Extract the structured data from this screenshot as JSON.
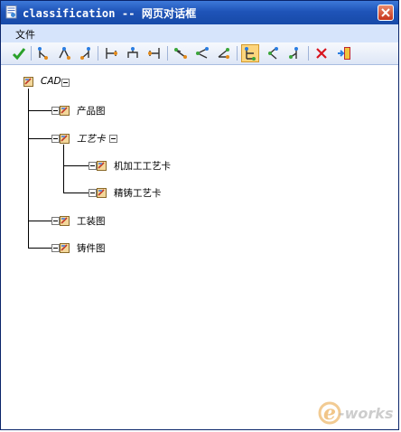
{
  "window": {
    "title": "classification -- 网页对话框"
  },
  "menu": {
    "file": "文件"
  },
  "toolbar": {
    "buttons": [
      "confirm-check-icon",
      "node-tool-1-icon",
      "node-tool-2-icon",
      "node-tool-3-icon",
      "align-tool-1-icon",
      "align-tool-2-icon",
      "align-tool-3-icon",
      "link-tool-1-icon",
      "link-tool-2-icon",
      "link-tool-3-icon",
      "tree-view-icon",
      "tree-tool-2-icon",
      "tree-tool-3-icon",
      "delete-x-icon",
      "exit-door-icon"
    ],
    "active": "tree-view-icon",
    "colors": {
      "check": "#2aa02a",
      "delete": "#d8141e",
      "active_bg": "#fdd57d"
    }
  },
  "tree": {
    "root": {
      "label": "CAD"
    },
    "children": [
      {
        "label": "产品图"
      },
      {
        "label": "工艺卡",
        "children": [
          {
            "label": "机加工工艺卡"
          },
          {
            "label": "精铸工艺卡"
          }
        ]
      },
      {
        "label": "工装图"
      },
      {
        "label": "铸件图"
      }
    ]
  },
  "watermark": {
    "logo_text": "e-works"
  }
}
